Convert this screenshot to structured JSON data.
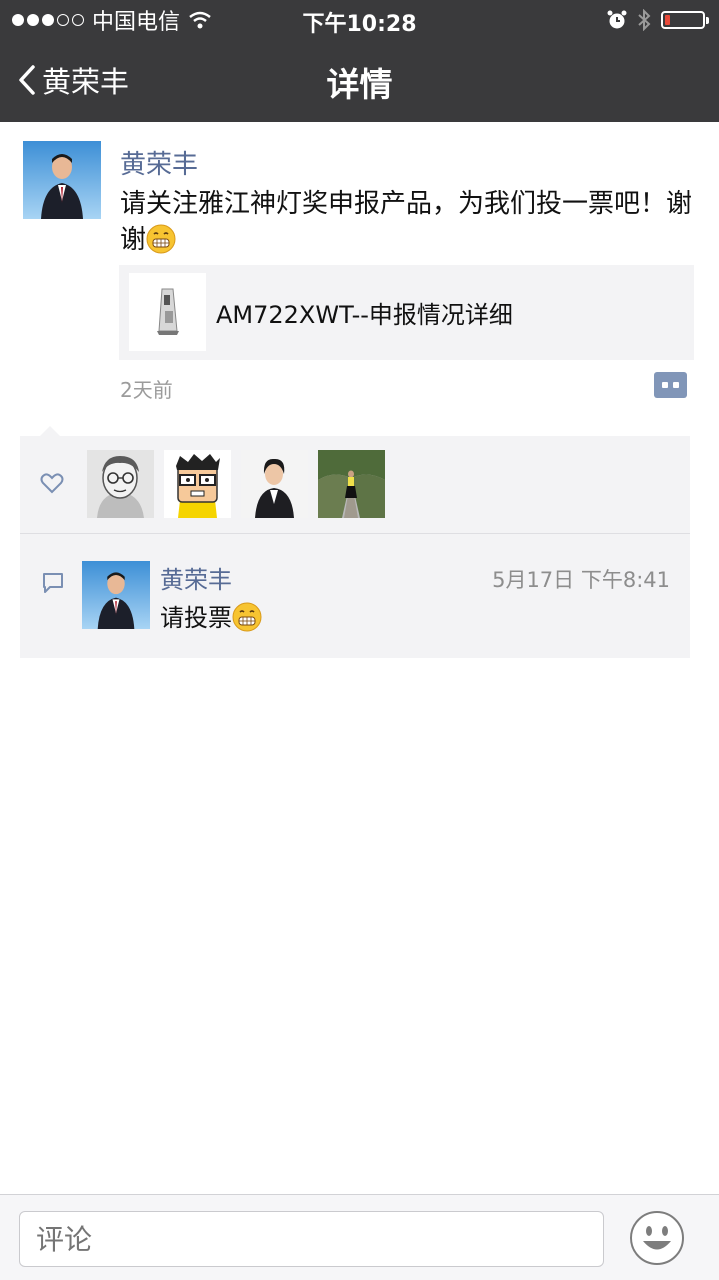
{
  "status_bar": {
    "carrier": "中国电信",
    "time": "下午10:28",
    "battery_color": "#e84a3a"
  },
  "nav": {
    "back_label": "黄荣丰",
    "title": "详情",
    "background": "#3a3a3c"
  },
  "post": {
    "author": "黄荣丰",
    "text": "请关注雅江神灯奖申报产品，为我们投一票吧！谢谢",
    "link_title": "AM722XWT--申报情况详细",
    "time": "2天前",
    "name_color": "#576b95"
  },
  "likes": {
    "icon": "heart-outline-icon",
    "likers": [
      "sketch-glasses-avatar",
      "cartoon-glasses-avatar",
      "woman-suit-avatar",
      "park-woman-avatar"
    ]
  },
  "comments": [
    {
      "author": "黄荣丰",
      "text": "请投票",
      "time": "5月17日 下午8:41"
    }
  ],
  "bottom": {
    "placeholder": "评论",
    "emoji_icon": "smiley-face-icon"
  }
}
